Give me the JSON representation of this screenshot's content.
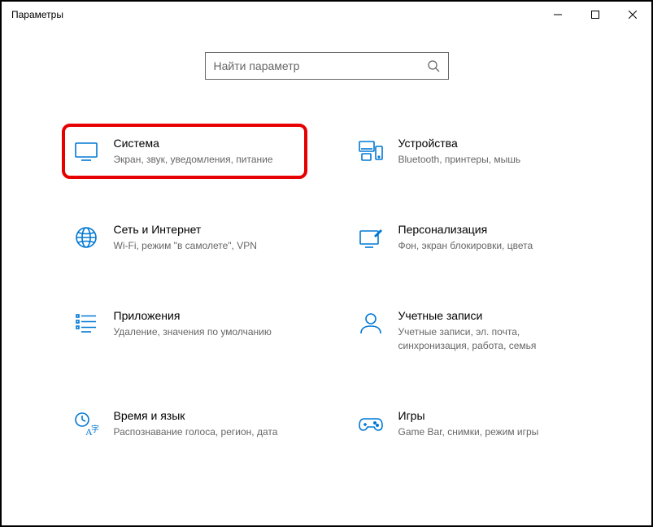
{
  "window": {
    "title": "Параметры"
  },
  "search": {
    "placeholder": "Найти параметр"
  },
  "tiles": {
    "system": {
      "title": "Система",
      "desc": "Экран, звук, уведомления, питание"
    },
    "devices": {
      "title": "Устройства",
      "desc": "Bluetooth, принтеры, мышь"
    },
    "network": {
      "title": "Сеть и Интернет",
      "desc": "Wi-Fi, режим \"в самолете\", VPN"
    },
    "personalize": {
      "title": "Персонализация",
      "desc": "Фон, экран блокировки, цвета"
    },
    "apps": {
      "title": "Приложения",
      "desc": "Удаление, значения по умолчанию"
    },
    "accounts": {
      "title": "Учетные записи",
      "desc": "Учетные записи, эл. почта, синхронизация, работа, семья"
    },
    "time": {
      "title": "Время и язык",
      "desc": "Распознавание голоса, регион, дата"
    },
    "gaming": {
      "title": "Игры",
      "desc": "Game Bar, снимки, режим игры"
    }
  }
}
